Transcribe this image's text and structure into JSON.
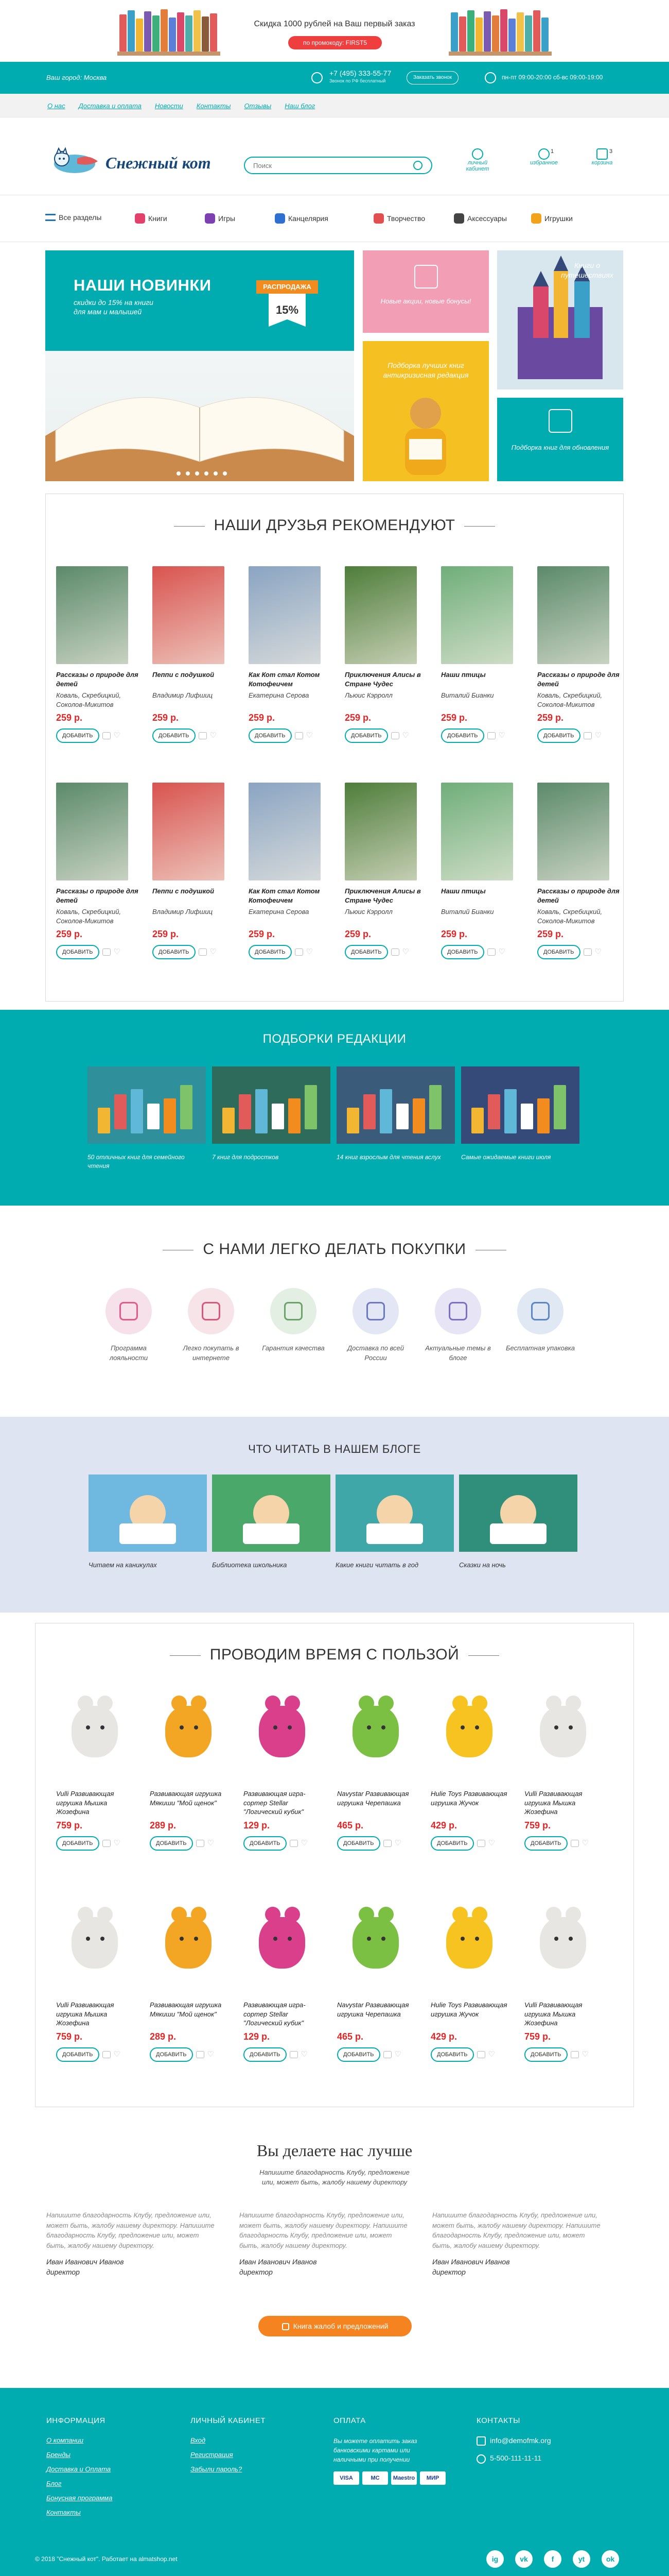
{
  "promo": {
    "text": "Скидка 1000 рублей на Ваш первый заказ",
    "button": "по промокоду: FIRST5"
  },
  "topbar": {
    "city": "Ваш город: Москва",
    "phone": "+7 (495) 333-55-77",
    "phone_note": "Звонок по РФ бесплатный",
    "callback": "Заказать звонок",
    "hours": "пн-пт 09:00-20:00   сб-вс 09:00-19:00"
  },
  "nav_links": [
    "О нас",
    "Доставка и оплата",
    "Новости",
    "Контакты",
    "Отзывы",
    "Наш блог"
  ],
  "header": {
    "logo": "Снежный кот",
    "search_placeholder": "Поиск",
    "cabinet": "личный кабинет",
    "favorites": "избранное",
    "favorites_count": "1",
    "cart": "корзина",
    "cart_count": "3"
  },
  "categories": [
    {
      "label": "Все разделы",
      "color": "#1c73b8"
    },
    {
      "label": "Книги",
      "color": "#e2416b"
    },
    {
      "label": "Игры",
      "color": "#7e3fb0"
    },
    {
      "label": "Канцелярия",
      "color": "#2f6fd0"
    },
    {
      "label": "Творчество",
      "color": "#e24f4f"
    },
    {
      "label": "Аксессуары",
      "color": "#444444"
    },
    {
      "label": "Игрушки",
      "color": "#f2a31a"
    }
  ],
  "hero": {
    "title": "НАШИ НОВИНКИ",
    "subtitle": "скидки до 15% на книги для мам и малышей",
    "sale_label": "РАСПРОДАЖА",
    "sale_value": "15%",
    "tile_pink": "Новые акции, новые бонусы!",
    "tile_travel": "Книги о путешествиях",
    "tile_orange": "Подборка лучших книг антикризисная редакция",
    "tile_teal": "Подборка книг для обновления"
  },
  "friends": {
    "title": "НАШИ ДРУЗЬЯ РЕКОМЕНДУЮТ",
    "products": [
      {
        "title": "Рассказы о природе для детей",
        "author": "Коваль, Скребицкий, Соколов-Микитов",
        "price": "259 р.",
        "buy": "ДОБАВИТЬ",
        "cover": "#5b8a6a"
      },
      {
        "title": "Пеппи с подушкой",
        "author": "Владимир Лифшиц",
        "price": "259 р.",
        "buy": "ДОБАВИТЬ",
        "cover": "#d9534f"
      },
      {
        "title": "Как Кот стал Котом Котофеичем",
        "author": "Екатерина Серова",
        "price": "259 р.",
        "buy": "ДОБАВИТЬ",
        "cover": "#8aa4c2"
      },
      {
        "title": "Приключения Алисы в Стране Чудес",
        "author": "Льюис Кэрролл",
        "price": "259 р.",
        "buy": "ДОБАВИТЬ",
        "cover": "#4e7d3a"
      },
      {
        "title": "Наши птицы",
        "author": "Виталий Бианки",
        "price": "259 р.",
        "buy": "ДОБАВИТЬ",
        "cover": "#6fae7a"
      },
      {
        "title": "Рассказы о природе для детей",
        "author": "Коваль, Скребицкий, Соколов-Микитов",
        "price": "259 р.",
        "buy": "ДОБАВИТЬ",
        "cover": "#5b8a6a"
      },
      {
        "title": "Рассказы о природе для детей",
        "author": "Коваль, Скребицкий, Соколов-Микитов",
        "price": "259 р.",
        "buy": "ДОБАВИТЬ",
        "cover": "#5b8a6a"
      },
      {
        "title": "Пеппи с подушкой",
        "author": "Владимир Лифшиц",
        "price": "259 р.",
        "buy": "ДОБАВИТЬ",
        "cover": "#d9534f"
      },
      {
        "title": "Как Кот стал Котом Котофеичем",
        "author": "Екатерина Серова",
        "price": "259 р.",
        "buy": "ДОБАВИТЬ",
        "cover": "#8aa4c2"
      },
      {
        "title": "Приключения Алисы в Стране Чудес",
        "author": "Льюис Кэрролл",
        "price": "259 р.",
        "buy": "ДОБАВИТЬ",
        "cover": "#4e7d3a"
      },
      {
        "title": "Наши птицы",
        "author": "Виталий Бианки",
        "price": "259 р.",
        "buy": "ДОБАВИТЬ",
        "cover": "#6fae7a"
      },
      {
        "title": "Рассказы о природе для детей",
        "author": "Коваль, Скребицкий, Соколов-Микитов",
        "price": "259 р.",
        "buy": "ДОБАВИТЬ",
        "cover": "#5b8a6a"
      }
    ]
  },
  "editorial": {
    "title": "ПОДБОРКИ РЕДАКЦИИ",
    "items": [
      {
        "caption": "50 отличных книг для семейного чтения",
        "color": "#2f8f9a"
      },
      {
        "caption": "7 книг для подростков",
        "color": "#2f6b5a"
      },
      {
        "caption": "14 книг взрослым для чтения вслух",
        "color": "#3a5b7a"
      },
      {
        "caption": "Самые ожидаемые книги июля",
        "color": "#364a7a"
      }
    ]
  },
  "easy": {
    "title": "С НАМИ ЛЕГКО ДЕЛАТЬ ПОКУПКИ",
    "items": [
      {
        "caption": "Программа лояльности",
        "bg": "#f6e1ea",
        "fg": "#e25b8a"
      },
      {
        "caption": "Легко покупать в интернете",
        "bg": "#f7e4e9",
        "fg": "#d9577a"
      },
      {
        "caption": "Гарантия качества",
        "bg": "#e2efe2",
        "fg": "#6aa26a"
      },
      {
        "caption": "Доставка по всей России",
        "bg": "#e3e6f4",
        "fg": "#6c78c2"
      },
      {
        "caption": "Актуальные темы в блоге",
        "bg": "#e6e4f5",
        "fg": "#7d6ec6"
      },
      {
        "caption": "Бесплатная упаковка",
        "bg": "#e0e8f4",
        "fg": "#5d86c4"
      }
    ]
  },
  "blog": {
    "title": "ЧТО ЧИТАТЬ В НАШЕМ БЛОГЕ",
    "items": [
      {
        "caption": "Читаем на каникулах",
        "color": "#6fb8e0"
      },
      {
        "caption": "Библиотека школьника",
        "color": "#49a86a"
      },
      {
        "caption": "Какие книги читать в год",
        "color": "#3fa7a8"
      },
      {
        "caption": "Сказки на ночь",
        "color": "#2f8f7a"
      }
    ]
  },
  "toys": {
    "title": "ПРОВОДИМ ВРЕМЯ С ПОЛЬЗОЙ",
    "products": [
      {
        "title": "Vulli Развивающая игрушка Мышка Жозефина",
        "price": "759 р.",
        "buy": "ДОБАВИТЬ",
        "color": "#e8e6e2"
      },
      {
        "title": "Развивающая игрушка Мякиши \"Мой щенок\"",
        "price": "289 р.",
        "buy": "ДОБАВИТЬ",
        "color": "#f2a624"
      },
      {
        "title": "Развивающая игра-сортер Stellar \"Логический кубик\"",
        "price": "129 р.",
        "buy": "ДОБАВИТЬ",
        "color": "#d93f8a"
      },
      {
        "title": "Navystar Развивающая игрушка Черепашка",
        "price": "465 р.",
        "buy": "ДОБАВИТЬ",
        "color": "#7cc043"
      },
      {
        "title": "Hulie Toys Развивающая игрушка Жучок",
        "price": "429 р.",
        "buy": "ДОБАВИТЬ",
        "color": "#f7c321"
      },
      {
        "title": "Vulli Развивающая игрушка Мышка Жозефина",
        "price": "759 р.",
        "buy": "ДОБАВИТЬ",
        "color": "#e8e6e2"
      },
      {
        "title": "Vulli Развивающая игрушка Мышка Жозефина",
        "price": "759 р.",
        "buy": "ДОБАВИТЬ",
        "color": "#e8e6e2"
      },
      {
        "title": "Развивающая игрушка Мякиши \"Мой щенок\"",
        "price": "289 р.",
        "buy": "ДОБАВИТЬ",
        "color": "#f2a624"
      },
      {
        "title": "Развивающая игра-сортер Stellar \"Логический кубик\"",
        "price": "129 р.",
        "buy": "ДОБАВИТЬ",
        "color": "#d93f8a"
      },
      {
        "title": "Navystar Развивающая игрушка Черепашка",
        "price": "465 р.",
        "buy": "ДОБАВИТЬ",
        "color": "#7cc043"
      },
      {
        "title": "Hulie Toys Развивающая игрушка Жучок",
        "price": "429 р.",
        "buy": "ДОБАВИТЬ",
        "color": "#f7c321"
      },
      {
        "title": "Vulli Развивающая игрушка Мышка Жозефина",
        "price": "759 р.",
        "buy": "ДОБАВИТЬ",
        "color": "#e8e6e2"
      }
    ]
  },
  "reviews": {
    "title": "Вы делаете нас лучше",
    "subtitle": "Напишите благодарность Клубу, предложение или, может быть, жалобу нашему директору",
    "items": [
      {
        "text": "Напишите благодарность Клубу, предложение или, может быть, жалобу нашему директору. Напишите благодарность Клубу, предложение или, может быть, жалобу нашему директору.",
        "name": "Иван Иванович Иванов",
        "role": "директор"
      },
      {
        "text": "Напишите благодарность Клубу, предложение или, может быть, жалобу нашему директору. Напишите благодарность Клубу, предложение или, может быть, жалобу нашему директору.",
        "name": "Иван Иванович Иванов",
        "role": "директор"
      },
      {
        "text": "Напишите благодарность Клубу, предложение или, может быть, жалобу нашему директору. Напишите благодарность Клубу, предложение или, может быть, жалобу нашему директору.",
        "name": "Иван Иванович Иванов",
        "role": "директор"
      }
    ],
    "button": "Книга жалоб и предложений"
  },
  "footer": {
    "info_title": "Информация",
    "info_links": [
      "О компании",
      "Бренды",
      "Доставка и Оплата",
      "Блог",
      "Бонусная программа",
      "Контакты"
    ],
    "cabinet_title": "Личный кабинет",
    "cabinet_links": [
      "Вход",
      "Регистрация",
      "Забыли пароль?"
    ],
    "pay_title": "Оплата",
    "pay_text": "Вы можете оплатить заказ банковскими картами или наличными при получении",
    "pay_methods": [
      "VISA",
      "MC",
      "Maestro",
      "МИР"
    ],
    "contacts_title": "Контакты",
    "email": "info@demofmk.org",
    "phone": "5-500-111-11-11",
    "copyright": "© 2018 \"Снежный кот\". Работает на almatshop.net",
    "social": [
      "ig",
      "vk",
      "f",
      "yt",
      "ok"
    ]
  }
}
